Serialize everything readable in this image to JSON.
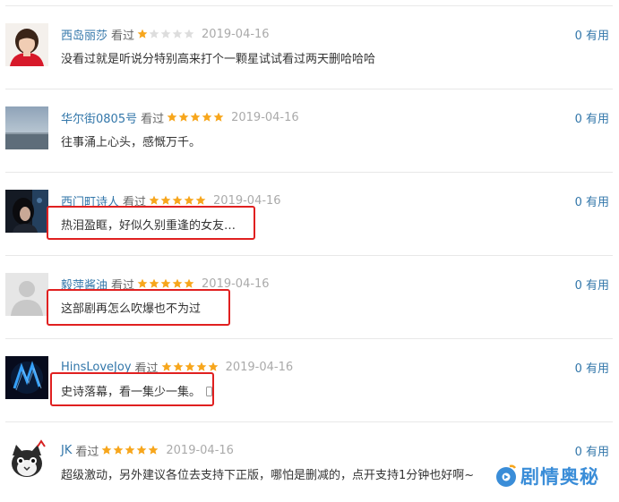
{
  "reviews": [
    {
      "user": "西岛丽莎",
      "action": "看过",
      "rating": 1,
      "date": "2019-04-16",
      "comment": "没看过就是听说分特别高来打个一颗星试试看过两天删哈哈哈",
      "useful": "0 有用",
      "avatar": "red-sweater-avatar",
      "highlighted": false
    },
    {
      "user": "华尔街0805号",
      "action": "看过",
      "rating": 5,
      "date": "2019-04-16",
      "comment": "往事涌上心头，感慨万千。",
      "useful": "0 有用",
      "avatar": "sea-horizon-avatar",
      "highlighted": false
    },
    {
      "user": "西门町诗人",
      "action": "看过",
      "rating": 5,
      "date": "2019-04-16",
      "comment": "热泪盈眶，好似久别重逢的女友…",
      "useful": "0 有用",
      "avatar": "dark-portrait-avatar",
      "highlighted": true
    },
    {
      "user": "毅萍酱油",
      "action": "看过",
      "rating": 5,
      "date": "2019-04-16",
      "comment": "这部剧再怎么吹爆也不为过",
      "useful": "0 有用",
      "avatar": "default-person-avatar",
      "highlighted": true
    },
    {
      "user": "HinsLoveJoy",
      "action": "看过",
      "rating": 5,
      "date": "2019-04-16",
      "comment": "史诗落幕，看一集少一集。",
      "useful": "0 有用",
      "avatar": "blue-neon-avatar",
      "highlighted": true,
      "mobile_icon": "mobile-phone-icon"
    },
    {
      "user": "JK",
      "action": "看过",
      "rating": 5,
      "date": "2019-04-16",
      "comment": "超级激动，另外建议各位去支持下正版，哪怕是删减的，点开支持1分钟也好啊~",
      "useful": "0 有用",
      "avatar": "cat-cartoon-avatar",
      "highlighted": false
    }
  ],
  "watermark": {
    "text": "剧情奥秘",
    "icon": "film-logo-icon"
  },
  "colors": {
    "username": "#3377aa",
    "star_on": "#f7a61c",
    "star_off": "#dddddd",
    "highlight": "#e02020",
    "watermark": "#3a8dd8"
  }
}
